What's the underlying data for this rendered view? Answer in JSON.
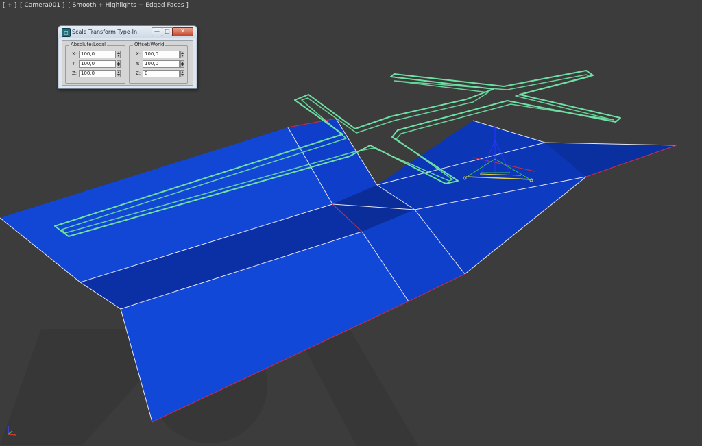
{
  "viewport": {
    "label_parts": [
      "[ + ]",
      "[ Camera001 ]",
      "[ Smooth + Highlights + Edged Faces ]"
    ],
    "colors": {
      "background": "#3c3c3c",
      "surface_main": "#0f3fd0",
      "surface_dark": "#0a2a94",
      "wire_edges": "#e6e6f0",
      "border_edges": "#b52f52",
      "road_spline": "#6ee0a4"
    }
  },
  "dialog": {
    "title": "Scale Transform Type-In",
    "app_icon": "3ds-max-app-icon",
    "buttons": {
      "minimize": "—",
      "maximize": "□",
      "close": "✕"
    },
    "absolute": {
      "title": "Absolute:Local",
      "fields": [
        {
          "label": "X:",
          "value": "100,0"
        },
        {
          "label": "Y:",
          "value": "100,0"
        },
        {
          "label": "Z:",
          "value": "100,0"
        }
      ]
    },
    "offset": {
      "title": "Offset:World",
      "fields": [
        {
          "label": "X:",
          "value": "100,0"
        },
        {
          "label": "Y:",
          "value": "100,0"
        },
        {
          "label": "Z:",
          "value": "0"
        }
      ]
    }
  }
}
